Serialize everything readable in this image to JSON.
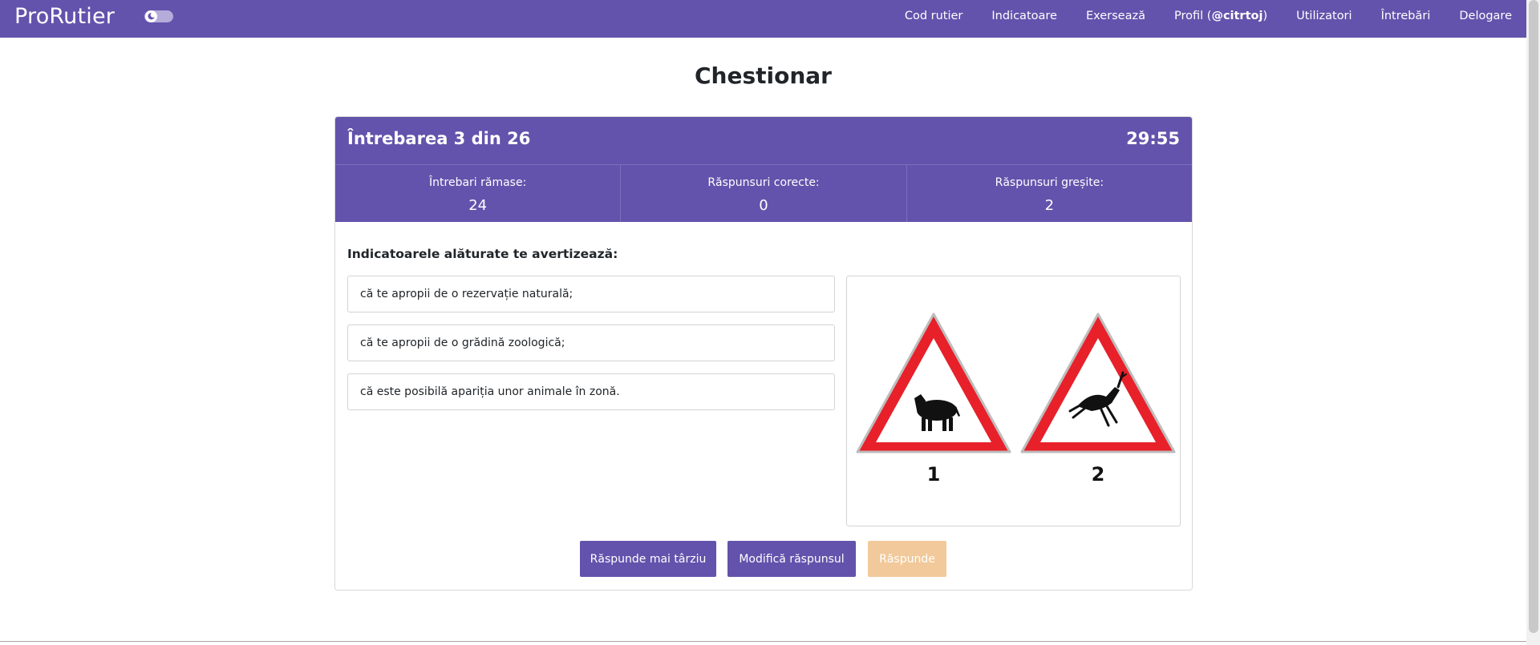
{
  "app": {
    "brand": "ProRutier"
  },
  "nav": {
    "items": [
      {
        "label": "Cod rutier"
      },
      {
        "label": "Indicatoare"
      },
      {
        "label": "Exersează"
      },
      {
        "label_prefix": "Profil (",
        "username": "@citrtoj",
        "label_suffix": ")"
      },
      {
        "label": "Utilizatori"
      },
      {
        "label": "Întrebări"
      },
      {
        "label": "Delogare"
      }
    ]
  },
  "page": {
    "title": "Chestionar"
  },
  "quiz": {
    "counter": "Întrebarea 3 din 26",
    "timer": "29:55",
    "stats": [
      {
        "label": "Întrebari rămase:",
        "value": "24"
      },
      {
        "label": "Răspunsuri corecte:",
        "value": "0"
      },
      {
        "label": "Răspunsuri greșite:",
        "value": "2"
      }
    ],
    "question": "Indicatoarele alăturate te avertizează:",
    "answers": [
      "că te apropii de o rezervație naturală;",
      "că te apropii de o grădină zoologică;",
      "că este posibilă apariția unor animale în zonă."
    ],
    "sign_numbers": [
      "1",
      "2"
    ],
    "buttons": {
      "later": "Răspunde mai târziu",
      "modify": "Modifică răspunsul",
      "answer": "Răspunde"
    }
  },
  "colors": {
    "primary": "#6353ac",
    "disabled_button": "#f2c99a",
    "sign_red": "#e8202a"
  },
  "icons": {
    "theme_toggle": "moon-icon"
  }
}
